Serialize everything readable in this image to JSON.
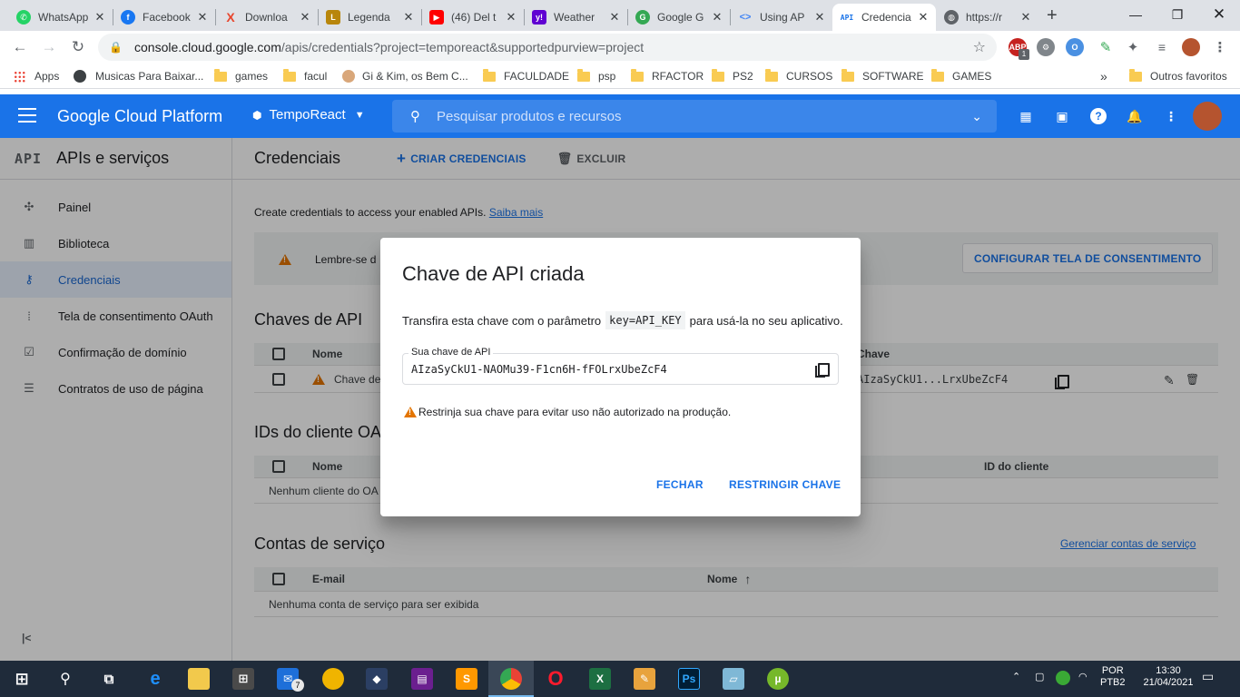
{
  "browser": {
    "tabs": [
      {
        "title": "WhatsApp",
        "icon": "whatsapp-icon",
        "color": "#25d366"
      },
      {
        "title": "Facebook",
        "icon": "facebook-icon",
        "color": "#1877f2"
      },
      {
        "title": "Downloa",
        "icon": "download-x-icon",
        "color": "#e8452c"
      },
      {
        "title": "Legenda",
        "icon": "legenda-icon",
        "color": "#b8860b"
      },
      {
        "title": "(46) Del t",
        "icon": "youtube-icon",
        "color": "#ff0000"
      },
      {
        "title": "Weather",
        "icon": "yahoo-icon",
        "color": "#6001d2"
      },
      {
        "title": "Google G",
        "icon": "google-g-icon",
        "color": "#34a853"
      },
      {
        "title": "Using AP",
        "icon": "code-icon",
        "color": "#4285f4"
      },
      {
        "title": "Credencia",
        "icon": "api-icon",
        "color": "#1a73e8"
      },
      {
        "title": "https://r",
        "icon": "globe-icon",
        "color": "#5f6368"
      }
    ],
    "url_host": "console.cloud.google.com",
    "url_path": "/apis/credentials?project=temporeact&supportedpurview=project",
    "bookmarks": [
      {
        "label": "Apps",
        "type": "apps"
      },
      {
        "label": "Musicas Para Baixar...",
        "type": "site"
      },
      {
        "label": "games",
        "type": "folder"
      },
      {
        "label": "facul",
        "type": "folder"
      },
      {
        "label": "Gi & Kim, os Bem C...",
        "type": "site"
      },
      {
        "label": "FACULDADE",
        "type": "folder"
      },
      {
        "label": "psp",
        "type": "folder"
      },
      {
        "label": "RFACTOR",
        "type": "folder"
      },
      {
        "label": "PS2",
        "type": "folder"
      },
      {
        "label": "CURSOS",
        "type": "folder"
      },
      {
        "label": "SOFTWARE",
        "type": "folder"
      },
      {
        "label": "GAMES",
        "type": "folder"
      }
    ],
    "bookmarks_more": "»",
    "other_favorites": "Outros favoritos",
    "ext_badge": "1"
  },
  "gcp": {
    "brand": "Google Cloud Platform",
    "project": "TempoReact",
    "search_placeholder": "Pesquisar produtos e recursos"
  },
  "sidebar": {
    "api_mark": "API",
    "title": "APIs e serviços",
    "items": [
      {
        "label": "Painel",
        "icon": "dashboard-icon"
      },
      {
        "label": "Biblioteca",
        "icon": "library-icon"
      },
      {
        "label": "Credenciais",
        "icon": "key-icon",
        "active": true
      },
      {
        "label": "Tela de consentimento OAuth",
        "icon": "consent-icon"
      },
      {
        "label": "Confirmação de domínio",
        "icon": "domain-check-icon"
      },
      {
        "label": "Contratos de uso de página",
        "icon": "page-settings-icon"
      }
    ]
  },
  "main": {
    "title": "Credenciais",
    "create_btn": "CRIAR CREDENCIAIS",
    "delete_btn": "EXCLUIR",
    "intro": "Create credentials to access your enabled APIs.",
    "learn_more": "Saiba mais",
    "banner_text": "Lembre-se d",
    "consent_btn": "CONFIGURAR TELA DE CONSENTIMENTO",
    "api_keys_title": "Chaves de API",
    "api_keys_cols": {
      "name": "Nome",
      "key": "Chave"
    },
    "api_key_row_name": "Chave de",
    "api_key_row_key": "AIzaSyCkU1...LrxUbeZcF4",
    "oauth_title": "IDs do cliente OAu",
    "oauth_cols": {
      "name": "Nome",
      "client_id": "ID do cliente"
    },
    "oauth_empty": "Nenhum cliente do OA",
    "service_title": "Contas de serviço",
    "service_manage": "Gerenciar contas de serviço",
    "service_cols": {
      "email": "E-mail",
      "name": "Nome"
    },
    "service_empty": "Nenhuma conta de serviço para ser exibida"
  },
  "dialog": {
    "title": "Chave de API criada",
    "body_pre": "Transfira esta chave com o parâmetro",
    "body_code": "key=API_KEY",
    "body_post": "para usá-la no seu aplicativo.",
    "field_label": "Sua chave de API",
    "api_key": "AIzaSyCkU1-NAOMu39-F1cn6H-fFOLrxUbeZcF4",
    "warning": "Restrinja sua chave para evitar uso não autorizado na produção.",
    "close_btn": "FECHAR",
    "restrict_btn": "RESTRINGIR CHAVE"
  },
  "taskbar": {
    "language": "POR",
    "layout": "PTB2",
    "time": "13:30",
    "date": "21/04/2021",
    "mail_badge": "7"
  }
}
